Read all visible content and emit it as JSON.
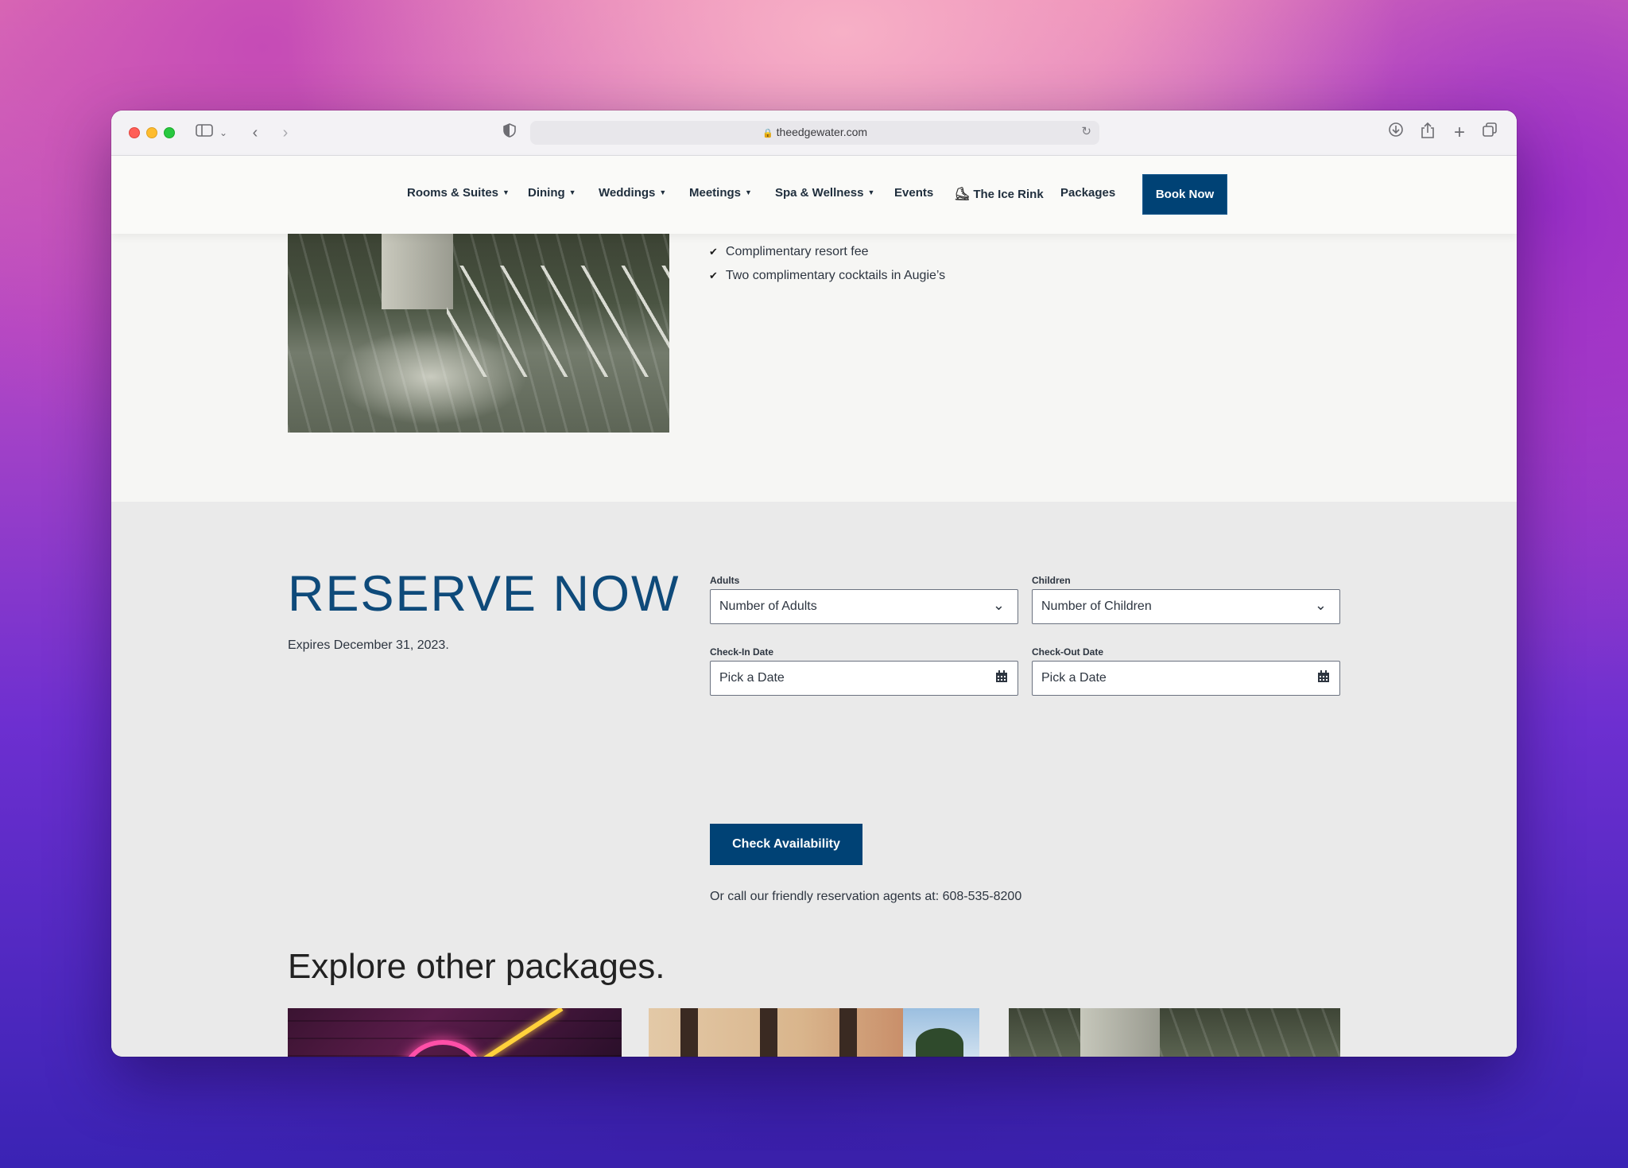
{
  "browser": {
    "url": "theedgewater.com"
  },
  "nav": {
    "items": [
      {
        "label": "Rooms & Suites",
        "dropdown": true
      },
      {
        "label": "Dining",
        "dropdown": true
      },
      {
        "label": "Weddings",
        "dropdown": true
      },
      {
        "label": "Meetings",
        "dropdown": true
      },
      {
        "label": "Spa & Wellness",
        "dropdown": true
      },
      {
        "label": "Events",
        "dropdown": false
      },
      {
        "label": "The Ice Rink",
        "dropdown": false,
        "icon": "ice-skate-icon"
      },
      {
        "label": "Packages",
        "dropdown": false
      }
    ],
    "book_now": "Book Now"
  },
  "package": {
    "benefits": [
      "Complimentary resort fee",
      "Two complimentary cocktails in Augie’s"
    ]
  },
  "reserve": {
    "title": "RESERVE NOW",
    "expires": "Expires December 31, 2023.",
    "adults_label": "Adults",
    "adults_value": "Number of Adults",
    "children_label": "Children",
    "children_value": "Number of Children",
    "checkin_label": "Check-In Date",
    "checkin_placeholder": "Pick a Date",
    "checkout_label": "Check-Out Date",
    "checkout_placeholder": "Pick a Date",
    "button": "Check Availability",
    "call_text": "Or call our friendly reservation agents at: 608-535-8200"
  },
  "explore": {
    "title": "Explore other packages."
  },
  "colors": {
    "brand_navy": "#004275",
    "title_blue": "#0e4a7a"
  }
}
